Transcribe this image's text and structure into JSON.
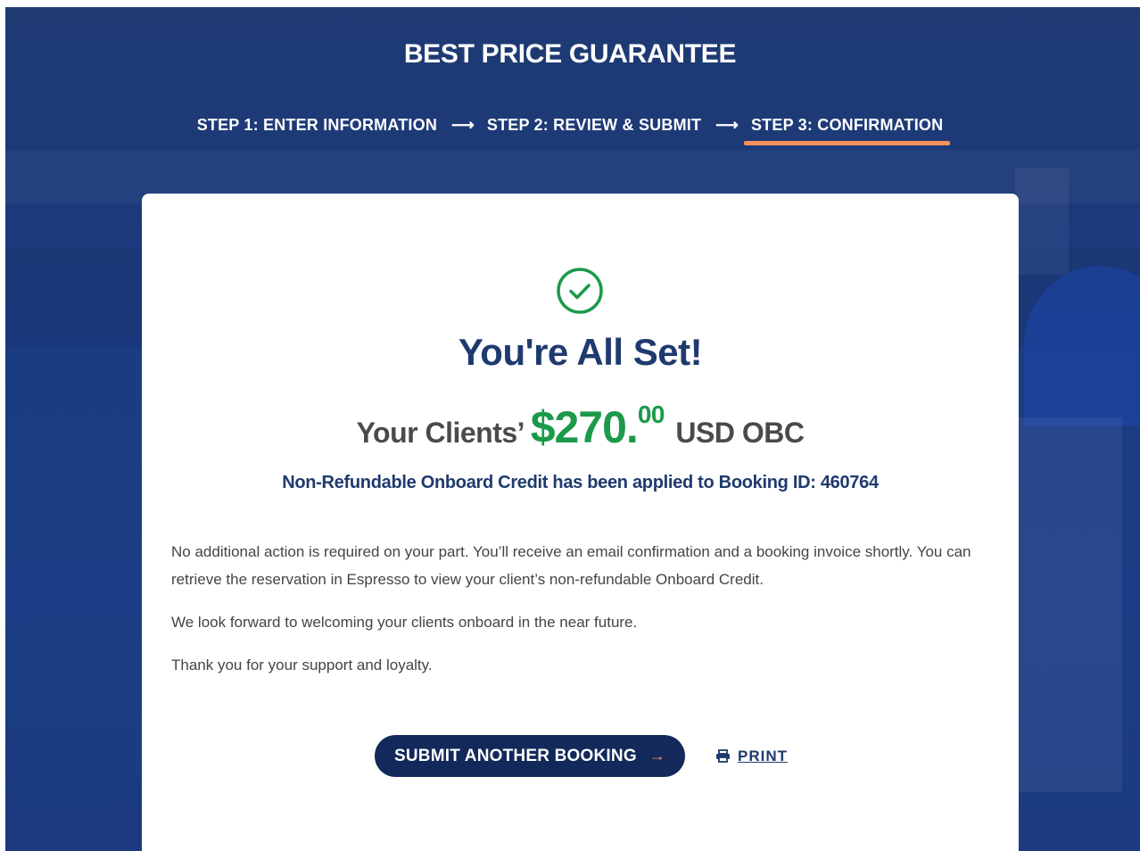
{
  "header": {
    "title": "BEST PRICE GUARANTEE"
  },
  "steps": [
    {
      "label": "STEP 1: ENTER INFORMATION",
      "active": false
    },
    {
      "label": "STEP 2: REVIEW & SUBMIT",
      "active": false
    },
    {
      "label": "STEP 3: CONFIRMATION",
      "active": true
    }
  ],
  "step_arrow": "⟶",
  "confirmation": {
    "icon": "check-circle-icon",
    "headline": "You're All Set!",
    "amount_prefix": "Your Clients’",
    "amount_whole": "$270.",
    "amount_cents": "00",
    "amount_suffix": "USD OBC",
    "subline": "Non-Refundable Onboard Credit has been applied to Booking ID: 460764",
    "paragraphs": [
      "No additional action is required on your part. You’ll receive an email confirmation and a booking invoice shortly. You can retrieve the reservation in Espresso to view your client’s non-refundable Onboard Credit.",
      "We look forward to welcoming your clients onboard in the near future.",
      "Thank you for your support and loyalty."
    ]
  },
  "actions": {
    "submit_label": "SUBMIT ANOTHER BOOKING",
    "submit_arrow": "→",
    "print_label": "PRINT",
    "print_icon": "printer-icon"
  },
  "colors": {
    "brand_navy": "#13295a",
    "headline_blue": "#1f3a6e",
    "success_green": "#1b9a4a",
    "accent_orange": "#f58f5c"
  }
}
